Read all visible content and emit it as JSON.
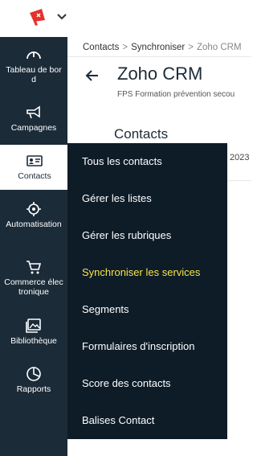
{
  "topbar": {
    "logo_icon": "megaphone-logo-icon",
    "menu_icon": "chevron-down-icon"
  },
  "sidebar": {
    "items": [
      {
        "label": "Tableau de bord",
        "icon": "gauge-icon"
      },
      {
        "label": "Campagnes",
        "icon": "megaphone-icon"
      },
      {
        "label": "Contacts",
        "icon": "contact-card-icon",
        "active": true
      },
      {
        "label": "Automatisation",
        "icon": "automation-gear-icon"
      },
      {
        "label": "Commerce électronique",
        "icon": "cart-icon"
      },
      {
        "label": "Bibliothèque",
        "icon": "image-library-icon"
      },
      {
        "label": "Rapports",
        "icon": "pie-chart-icon"
      }
    ]
  },
  "breadcrumb": {
    "items": [
      "Contacts",
      "Synchroniser",
      "Zoho CRM"
    ]
  },
  "header": {
    "title": "Zoho CRM",
    "subtitle": "FPS Formation prévention secou"
  },
  "main": {
    "heading": "Contacts",
    "year": "2023"
  },
  "flyout": {
    "items": [
      "Tous les contacts",
      "Gérer les listes",
      "Gérer les rubriques",
      "Synchroniser les services",
      "Segments",
      "Formulaires d'inscription",
      "Score des contacts",
      "Balises Contact"
    ],
    "highlight_color": "#f5e44a"
  },
  "colors": {
    "sidebar": "#1b2b38",
    "flyout": "#0e1c28",
    "logo_red": "#e4312b"
  }
}
